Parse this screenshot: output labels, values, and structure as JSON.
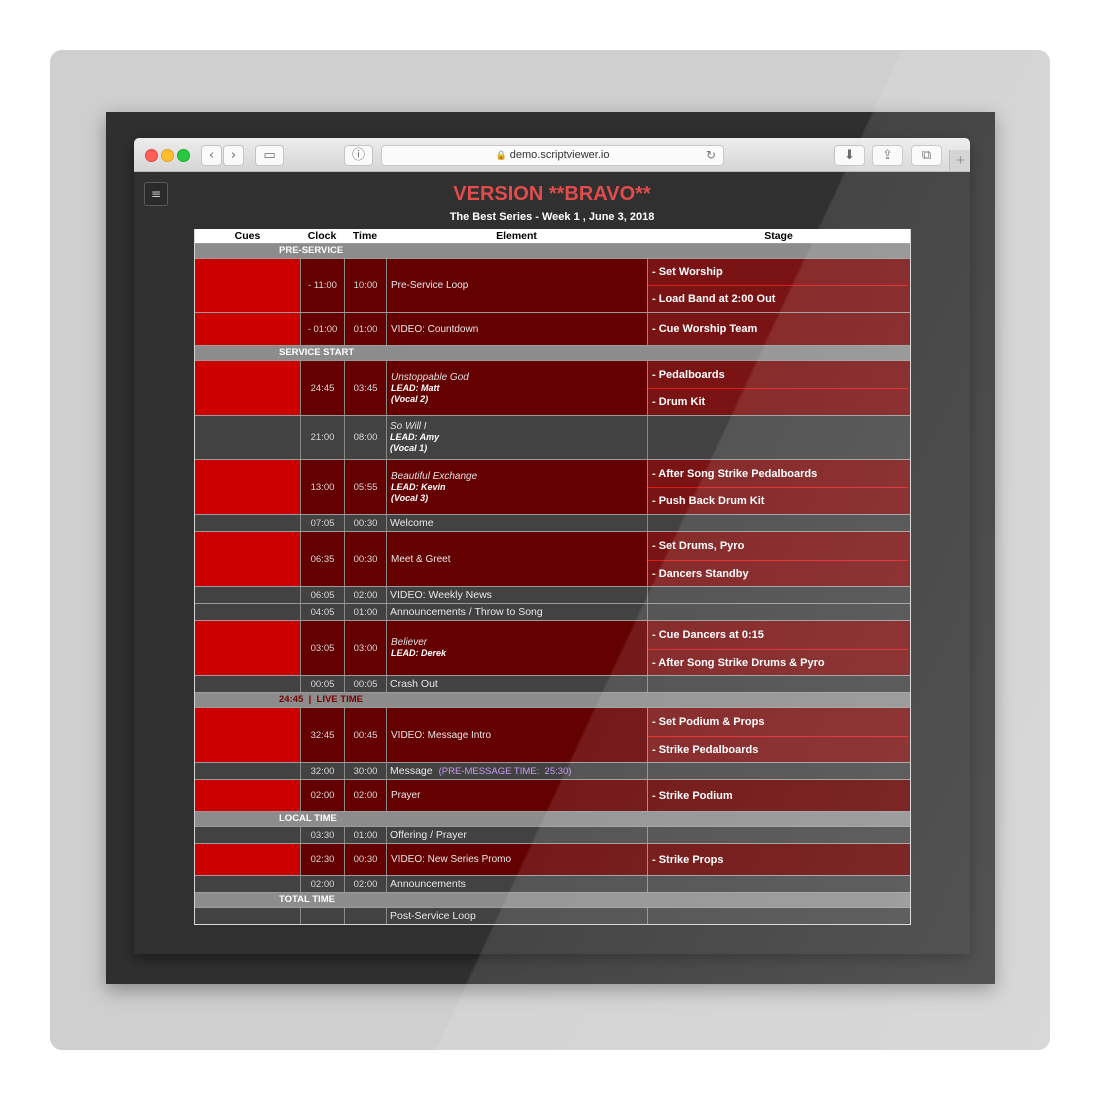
{
  "browser": {
    "url": "demo.scriptviewer.io",
    "lock_icon": "🔒",
    "reload_icon": "↻",
    "plus_label": "+",
    "buttons": {
      "back": "‹",
      "forward": "›",
      "sidebar": "▭",
      "reader": "ⓘ",
      "download": "⬇",
      "share": "⇪",
      "tabs": "⧉"
    }
  },
  "menu_icon": "≡",
  "page": {
    "title": "VERSION **BRAVO**",
    "subtitle": "The Best Series - Week 1 , June 3, 2018"
  },
  "columns": [
    "Cues",
    "Clock",
    "Time",
    "Element",
    "Stage"
  ],
  "sections": {
    "pre_service": "PRE-SERVICE",
    "service_start": "SERVICE START",
    "live_time": "24:45  |  LIVE TIME",
    "local_time": "LOCAL TIME",
    "total_time": "TOTAL TIME"
  },
  "rows": {
    "preloop": {
      "clock": "- 11:00",
      "time": "10:00",
      "element": "Pre-Service Loop",
      "stage": [
        "- Set Worship",
        "- Load Band at 2:00 Out"
      ]
    },
    "countdown": {
      "clock": "- 01:00",
      "time": "01:00",
      "element": "VIDEO: Countdown",
      "stage": [
        "- Cue Worship Team"
      ]
    },
    "unstoppable": {
      "clock": "24:45",
      "time": "03:45",
      "song": "Unstoppable God",
      "lead": "LEAD: Matt",
      "vocal": "(Vocal 2)",
      "stage": [
        "- Pedalboards",
        "- Drum Kit"
      ]
    },
    "sowilli": {
      "clock": "21:00",
      "time": "08:00",
      "song": "So Will I",
      "lead": "LEAD: Amy",
      "vocal": "(Vocal 1)"
    },
    "beautiful": {
      "clock": "13:00",
      "time": "05:55",
      "song": "Beautiful Exchange",
      "lead": "LEAD: Kevin",
      "vocal": "(Vocal 3)",
      "stage": [
        "- After Song Strike Pedalboards",
        "- Push Back Drum Kit"
      ]
    },
    "welcome": {
      "clock": "07:05",
      "time": "00:30",
      "element": "Welcome"
    },
    "meet": {
      "clock": "06:35",
      "time": "00:30",
      "element": "Meet & Greet",
      "stage": [
        "- Set Drums, Pyro",
        "- Dancers Standby"
      ]
    },
    "news": {
      "clock": "06:05",
      "time": "02:00",
      "element": "VIDEO: Weekly News"
    },
    "announce1": {
      "clock": "04:05",
      "time": "01:00",
      "element": "Announcements / Throw to Song"
    },
    "believer": {
      "clock": "03:05",
      "time": "03:00",
      "song": "Believer",
      "lead": "LEAD: Derek",
      "stage": [
        "- Cue Dancers at 0:15",
        "- After Song Strike Drums & Pyro"
      ]
    },
    "crash": {
      "clock": "00:05",
      "time": "00:05",
      "element": "Crash Out"
    },
    "msgintro": {
      "clock": "32:45",
      "time": "00:45",
      "element": "VIDEO: Message Intro",
      "stage": [
        "- Set Podium & Props",
        "- Strike Pedalboards"
      ]
    },
    "message": {
      "clock": "32:00",
      "time": "30:00",
      "element": "Message",
      "note": "(PRE-MESSAGE TIME:  25:30)"
    },
    "prayer": {
      "clock": "02:00",
      "time": "02:00",
      "element": "Prayer",
      "stage": [
        "- Strike Podium"
      ]
    },
    "offering": {
      "clock": "03:30",
      "time": "01:00",
      "element": "Offering / Prayer"
    },
    "promo": {
      "clock": "02:30",
      "time": "00:30",
      "element": "VIDEO: New Series Promo",
      "stage": [
        "- Strike Props"
      ]
    },
    "announce2": {
      "clock": "02:00",
      "time": "02:00",
      "element": "Announcements"
    },
    "postloop": {
      "element": "Post-Service Loop"
    }
  },
  "colors": {
    "title": "#e34c4c",
    "cue": "#cc0000",
    "cue_row": "#650000",
    "stage_row": "#7a1414",
    "section": "#8c8c8c",
    "note": "#c99cf2"
  }
}
